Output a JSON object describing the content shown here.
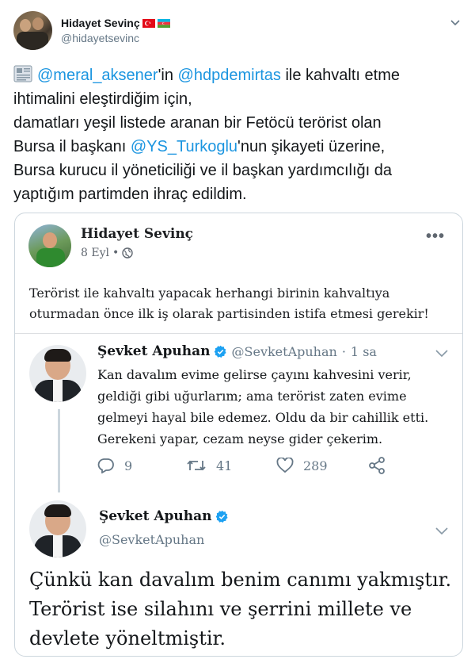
{
  "tweet": {
    "author_name": "Hidayet Sevinç",
    "author_handle": "@hidayetsevinc",
    "icons": [
      "turkey-flag-icon",
      "azerbaijan-flag-icon",
      "chevron-down-icon",
      "newspaper-icon"
    ],
    "lines": [
      [
        "",
        "@meral_aksener",
        "'in ",
        "@hdpdemirtas",
        " ile kahvaltı etme"
      ],
      [
        "ihtimalini eleştirdiğim için,"
      ],
      [
        "damatları yeşil listede aranan bir Fetöcü terörist olan"
      ],
      [
        "Bursa il başkanı ",
        "@YS_Turkoglu",
        "'nun şikayeti üzerine,"
      ],
      [
        "Bursa kurucu il yöneticiliği ve il başkan yardımcılığı da"
      ],
      [
        "yaptığım partimden ihraç edildim."
      ]
    ],
    "colors": {
      "link": "#1b95e0",
      "text": "#14171a",
      "secondary": "#657786",
      "border": "#ccd6dd"
    }
  },
  "facebook_post": {
    "author_name": "Hidayet Sevinç",
    "date": "8 Eyl",
    "separator": "•",
    "more": "•••",
    "lines": [
      "Terörist ile kahvaltı yapacak herhangi birinin kahvaltıya",
      "oturmadan önce ilk iş olarak partisinden istifa etmesi gerekir!"
    ]
  },
  "quoted_tweet_1": {
    "author_name": "Şevket Apuhan",
    "author_handle": "@SevketApuhan",
    "separator": "·",
    "time": "1 sa",
    "lines": [
      "Kan davalım evime gelirse çayını kahvesini verir,",
      "geldiği gibi uğurlarım; ama terörist zaten evime",
      "gelmeyi hayal bile edemez. Oldu da bir cahillik etti.",
      "Gerekeni yapar, cezam neyse gider çekerim."
    ],
    "replies": "9",
    "retweets": "41",
    "likes": "289"
  },
  "quoted_tweet_2": {
    "author_name": "Şevket Apuhan",
    "author_handle": "@SevketApuhan",
    "lines": [
      "Çünkü kan davalım benim canımı yakmıştır.",
      "Terörist ise silahını ve şerrini millete ve",
      "devlete yöneltmiştir."
    ]
  }
}
